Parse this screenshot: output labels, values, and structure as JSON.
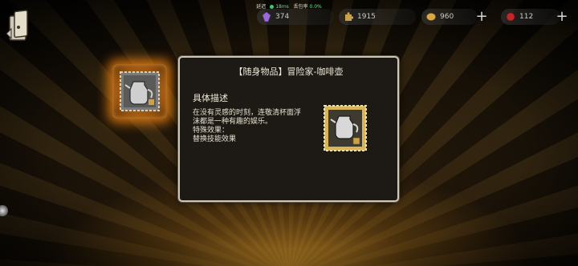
{
  "status": {
    "latency_label": "延迟",
    "latency_value": "18ms",
    "loss_label": "丢包率",
    "loss_value": "0.0%"
  },
  "currencies": [
    {
      "icon": "purple-crystal-icon",
      "value": "374"
    },
    {
      "icon": "gold-puzzle-icon",
      "value": "1915"
    },
    {
      "icon": "gold-coin-icon",
      "value": "960"
    },
    {
      "icon": "red-gem-icon",
      "value": "112"
    }
  ],
  "modal": {
    "title": "【随身物品】冒险家-咖啡壶",
    "section_title": "具体描述",
    "description": "在没有灵感的时刻，连敬清杯面浮沫都是一种有趣的娱乐。",
    "effect_label": "特殊效果：",
    "effect_text": "替换技能效果"
  },
  "colors": {
    "accent_gold": "#c9a24a",
    "glow_orange": "#ff8c14",
    "modal_border": "#cfc7b6"
  }
}
